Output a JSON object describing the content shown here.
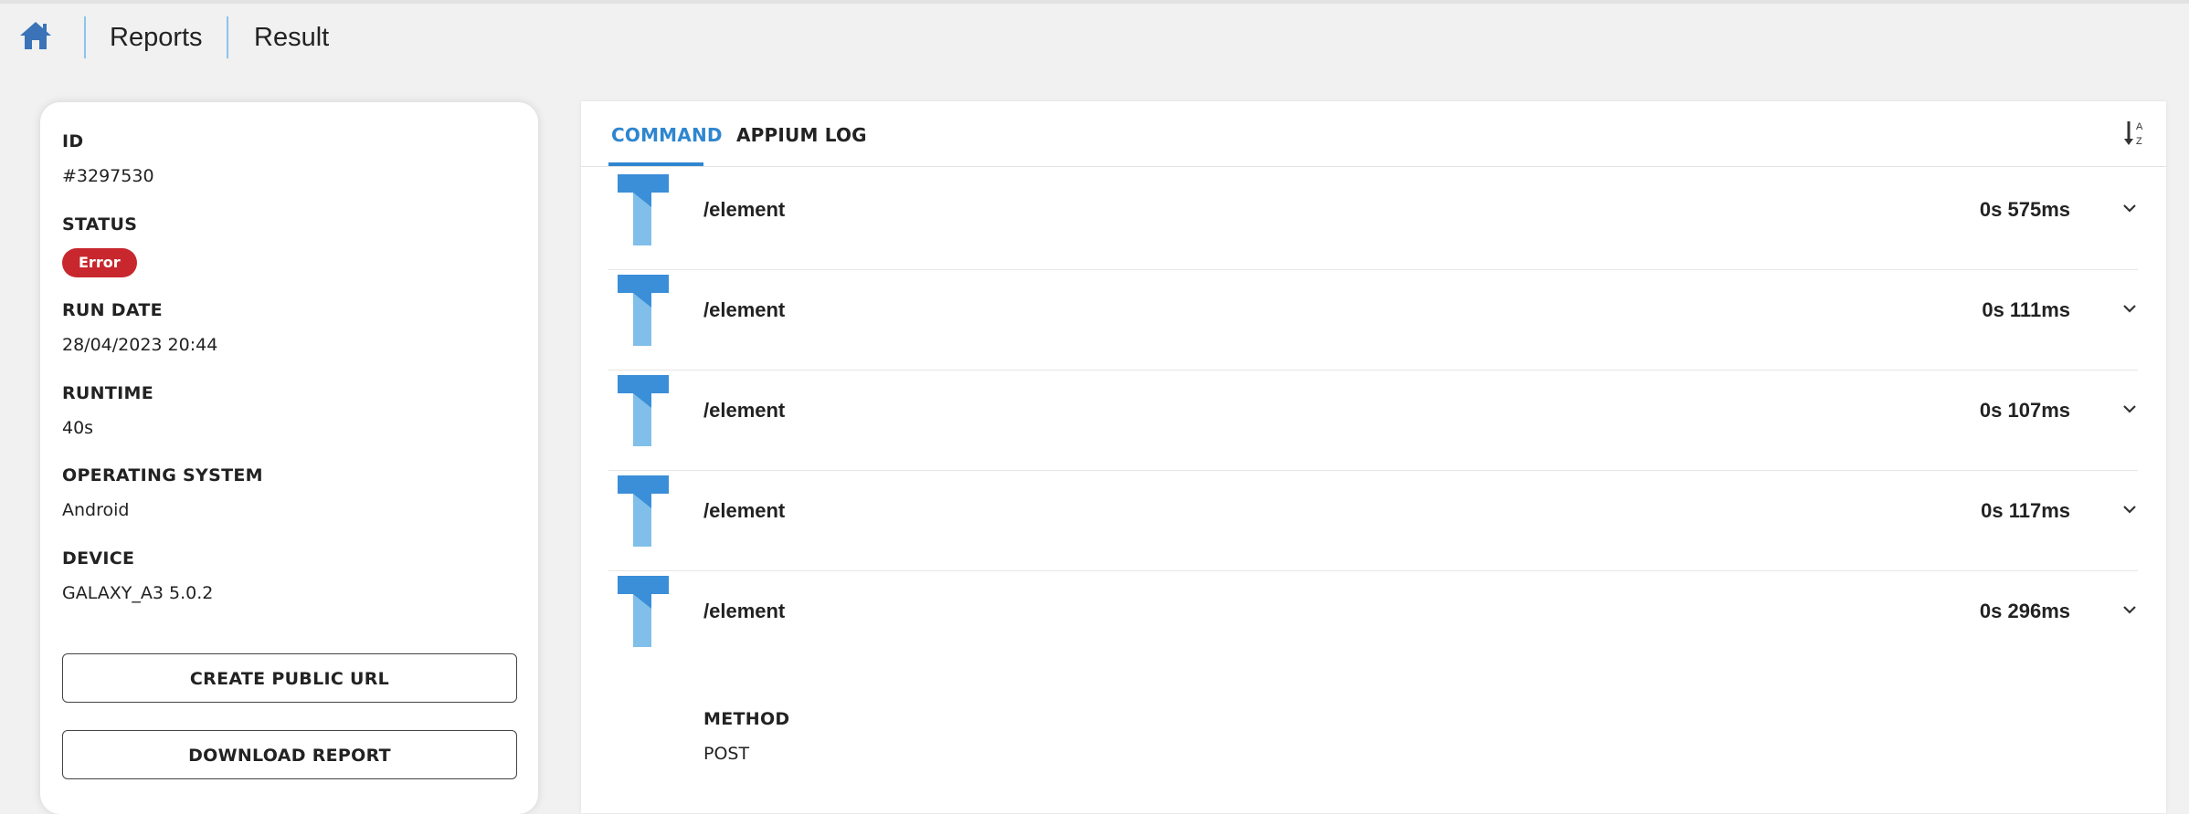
{
  "breadcrumb": {
    "home_icon": "home-icon",
    "items": [
      "Reports",
      "Result"
    ]
  },
  "colors": {
    "accent": "#2f86cf",
    "error": "#c8272e",
    "icon_dark": "#3b8ed8",
    "icon_light": "#7fbfea"
  },
  "info": {
    "id_label": "ID",
    "id_value": "#3297530",
    "status_label": "STATUS",
    "status_value": "Error",
    "run_date_label": "RUN DATE",
    "run_date_value": "28/04/2023 20:44",
    "runtime_label": "RUNTIME",
    "runtime_value": "40s",
    "os_label": "OPERATING SYSTEM",
    "os_value": "Android",
    "device_label": "DEVICE",
    "device_value": "GALAXY_A3 5.0.2",
    "create_url_button": "CREATE PUBLIC URL",
    "download_button": "DOWNLOAD REPORT"
  },
  "tabs": [
    {
      "label": "COMMAND",
      "active": true
    },
    {
      "label": "APPIUM LOG",
      "active": false
    }
  ],
  "sort_icon": "sort-alpha-icon",
  "commands": [
    {
      "icon": "text-command-icon",
      "path": "/element",
      "duration": "0s 575ms"
    },
    {
      "icon": "text-command-icon",
      "path": "/element",
      "duration": "0s 111ms"
    },
    {
      "icon": "text-command-icon",
      "path": "/element",
      "duration": "0s 107ms"
    },
    {
      "icon": "text-command-icon",
      "path": "/element",
      "duration": "0s 117ms"
    },
    {
      "icon": "text-command-icon",
      "path": "/element",
      "duration": "0s 296ms"
    }
  ],
  "expanded_detail": {
    "method_label": "METHOD",
    "method_value": "POST"
  }
}
